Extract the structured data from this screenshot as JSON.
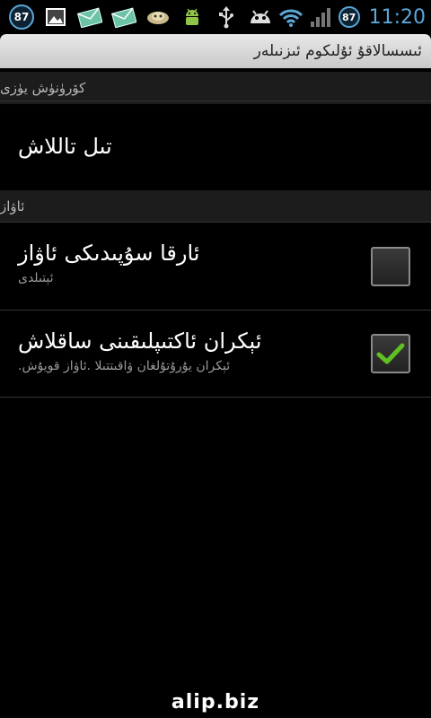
{
  "status_bar": {
    "notification_badge": "87",
    "battery_level": "87",
    "time": "11:20",
    "icons": [
      "notification-badge-icon",
      "gallery-icon",
      "email-icon",
      "email-icon",
      "sync-icon",
      "android-debug-icon",
      "usb-icon",
      "android-icon",
      "wifi-icon",
      "signal-icon",
      "battery-icon"
    ]
  },
  "title_bar": {
    "title": "ئىسسالاقۇ ئۇلىكوم ئىزنىلەر"
  },
  "sections": [
    {
      "header": "كۆرۈنۈش يۈزى"
    },
    {
      "header": "ئاۋاز"
    }
  ],
  "prefs": [
    {
      "title": "تىل تاللاش",
      "summary": ""
    },
    {
      "title": "ئارقا سۇپىدىكى ئاۋاز",
      "summary": "ئېتىلدى",
      "checked": false
    },
    {
      "title": "ئېكران ئاكتىپلىقىنى ساقلاش",
      "summary": "ئېكران يۇرۇتۇلغان ۋاقىتتىلا .ئاۋاز قويۇش.",
      "checked": true
    }
  ],
  "watermark": "alip.biz",
  "colors": {
    "accent": "#5aa7d8",
    "check_green": "#5ec023"
  }
}
